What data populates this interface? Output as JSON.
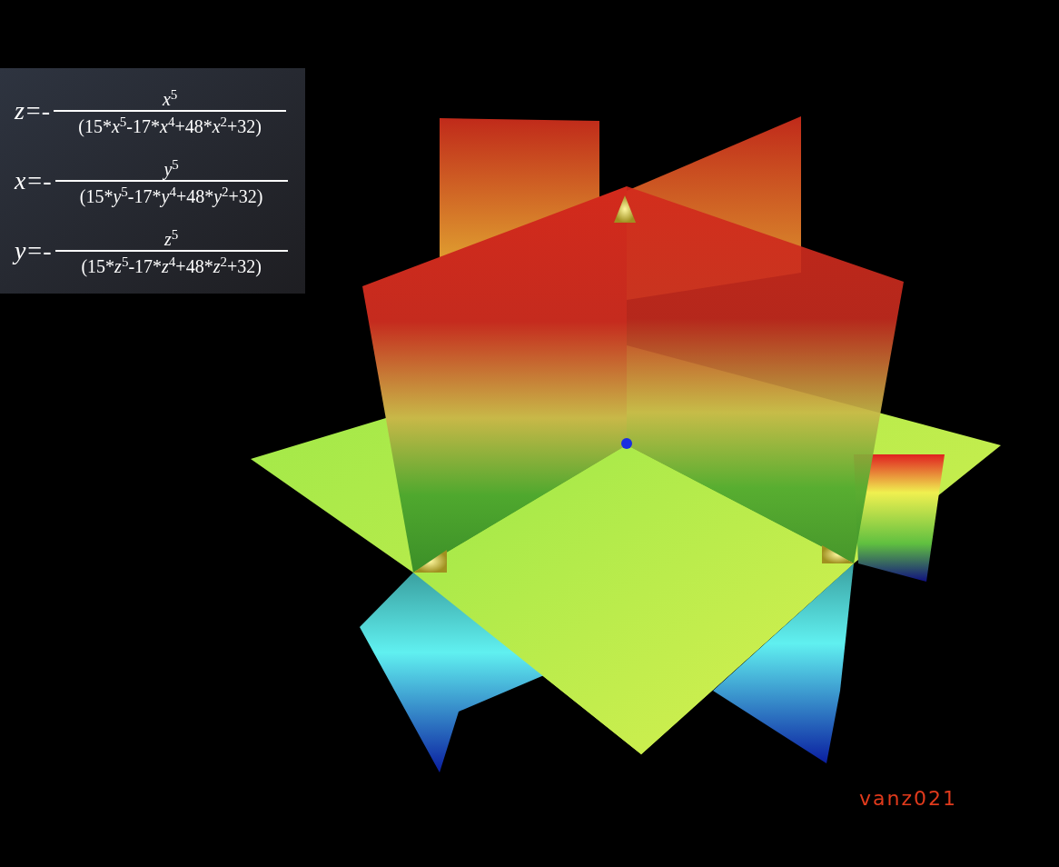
{
  "equations": [
    {
      "lhs": "z=-",
      "numerator": [
        {
          "kind": "var",
          "text": "x"
        },
        {
          "kind": "sup",
          "text": "5"
        }
      ],
      "denominator": [
        {
          "kind": "num",
          "text": "(15*"
        },
        {
          "kind": "var",
          "text": "x"
        },
        {
          "kind": "sup",
          "text": "5"
        },
        {
          "kind": "num",
          "text": "-17*"
        },
        {
          "kind": "var",
          "text": "x"
        },
        {
          "kind": "sup",
          "text": "4"
        },
        {
          "kind": "num",
          "text": "+48*"
        },
        {
          "kind": "var",
          "text": "x"
        },
        {
          "kind": "sup",
          "text": "2"
        },
        {
          "kind": "num",
          "text": "+32)"
        }
      ]
    },
    {
      "lhs": "x=-",
      "numerator": [
        {
          "kind": "var",
          "text": "y"
        },
        {
          "kind": "sup",
          "text": "5"
        }
      ],
      "denominator": [
        {
          "kind": "num",
          "text": "(15*"
        },
        {
          "kind": "var",
          "text": "y"
        },
        {
          "kind": "sup",
          "text": "5"
        },
        {
          "kind": "num",
          "text": "-17*"
        },
        {
          "kind": "var",
          "text": "y"
        },
        {
          "kind": "sup",
          "text": "4"
        },
        {
          "kind": "num",
          "text": "+48*"
        },
        {
          "kind": "var",
          "text": "y"
        },
        {
          "kind": "sup",
          "text": "2"
        },
        {
          "kind": "num",
          "text": "+32)"
        }
      ]
    },
    {
      "lhs": "y=-",
      "numerator": [
        {
          "kind": "var",
          "text": "z"
        },
        {
          "kind": "sup",
          "text": "5"
        }
      ],
      "denominator": [
        {
          "kind": "num",
          "text": "(15*"
        },
        {
          "kind": "var",
          "text": "z"
        },
        {
          "kind": "sup",
          "text": "5"
        },
        {
          "kind": "num",
          "text": "-17*"
        },
        {
          "kind": "var",
          "text": "z"
        },
        {
          "kind": "sup",
          "text": "4"
        },
        {
          "kind": "num",
          "text": "+48*"
        },
        {
          "kind": "var",
          "text": "z"
        },
        {
          "kind": "sup",
          "text": "2"
        },
        {
          "kind": "num",
          "text": "+32)"
        }
      ]
    }
  ],
  "signature": "vanz021"
}
